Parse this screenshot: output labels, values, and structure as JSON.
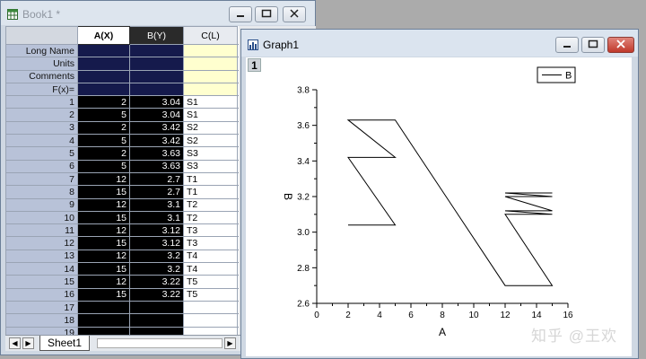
{
  "workbook": {
    "title": "Book1 *",
    "columns": [
      "A(X)",
      "B(Y)",
      "C(L)"
    ],
    "meta_rows": [
      "Long Name",
      "Units",
      "Comments",
      "F(x)="
    ],
    "rows": [
      {
        "n": "1",
        "a": "2",
        "b": "3.04",
        "c": "S1"
      },
      {
        "n": "2",
        "a": "5",
        "b": "3.04",
        "c": "S1"
      },
      {
        "n": "3",
        "a": "2",
        "b": "3.42",
        "c": "S2"
      },
      {
        "n": "4",
        "a": "5",
        "b": "3.42",
        "c": "S2"
      },
      {
        "n": "5",
        "a": "2",
        "b": "3.63",
        "c": "S3"
      },
      {
        "n": "6",
        "a": "5",
        "b": "3.63",
        "c": "S3"
      },
      {
        "n": "7",
        "a": "12",
        "b": "2.7",
        "c": "T1"
      },
      {
        "n": "8",
        "a": "15",
        "b": "2.7",
        "c": "T1"
      },
      {
        "n": "9",
        "a": "12",
        "b": "3.1",
        "c": "T2"
      },
      {
        "n": "10",
        "a": "15",
        "b": "3.1",
        "c": "T2"
      },
      {
        "n": "11",
        "a": "12",
        "b": "3.12",
        "c": "T3"
      },
      {
        "n": "12",
        "a": "15",
        "b": "3.12",
        "c": "T3"
      },
      {
        "n": "13",
        "a": "12",
        "b": "3.2",
        "c": "T4"
      },
      {
        "n": "14",
        "a": "15",
        "b": "3.2",
        "c": "T4"
      },
      {
        "n": "15",
        "a": "12",
        "b": "3.22",
        "c": "T5"
      },
      {
        "n": "16",
        "a": "15",
        "b": "3.22",
        "c": "T5"
      },
      {
        "n": "17",
        "a": "",
        "b": "",
        "c": ""
      },
      {
        "n": "18",
        "a": "",
        "b": "",
        "c": ""
      },
      {
        "n": "19",
        "a": "",
        "b": "",
        "c": ""
      }
    ],
    "sheet_tab": "Sheet1"
  },
  "graph": {
    "title": "Graph1",
    "layer": "1"
  },
  "chart_data": {
    "type": "line",
    "xlabel": "A",
    "ylabel": "B",
    "xlim": [
      0,
      16
    ],
    "ylim": [
      2.6,
      3.8
    ],
    "xticks": [
      "0",
      "2",
      "4",
      "6",
      "8",
      "10",
      "12",
      "14",
      "16"
    ],
    "yticks": [
      "2.6",
      "2.8",
      "3.0",
      "3.2",
      "3.4",
      "3.6",
      "3.8"
    ],
    "legend": "B",
    "legend_position": "top-right",
    "series": [
      {
        "name": "B",
        "x": [
          2,
          5,
          2,
          5,
          2,
          5,
          12,
          15,
          12,
          15,
          12,
          15,
          12,
          15,
          12,
          15
        ],
        "y": [
          3.04,
          3.04,
          3.42,
          3.42,
          3.63,
          3.63,
          2.7,
          2.7,
          3.1,
          3.1,
          3.12,
          3.12,
          3.2,
          3.2,
          3.22,
          3.22
        ]
      }
    ]
  },
  "watermark": "知乎 @王欢",
  "colors": {
    "selected_column": "#000000",
    "label_column": "#ffffcf",
    "row_header": "#b8c2d8",
    "close_button": "#c0392b"
  }
}
